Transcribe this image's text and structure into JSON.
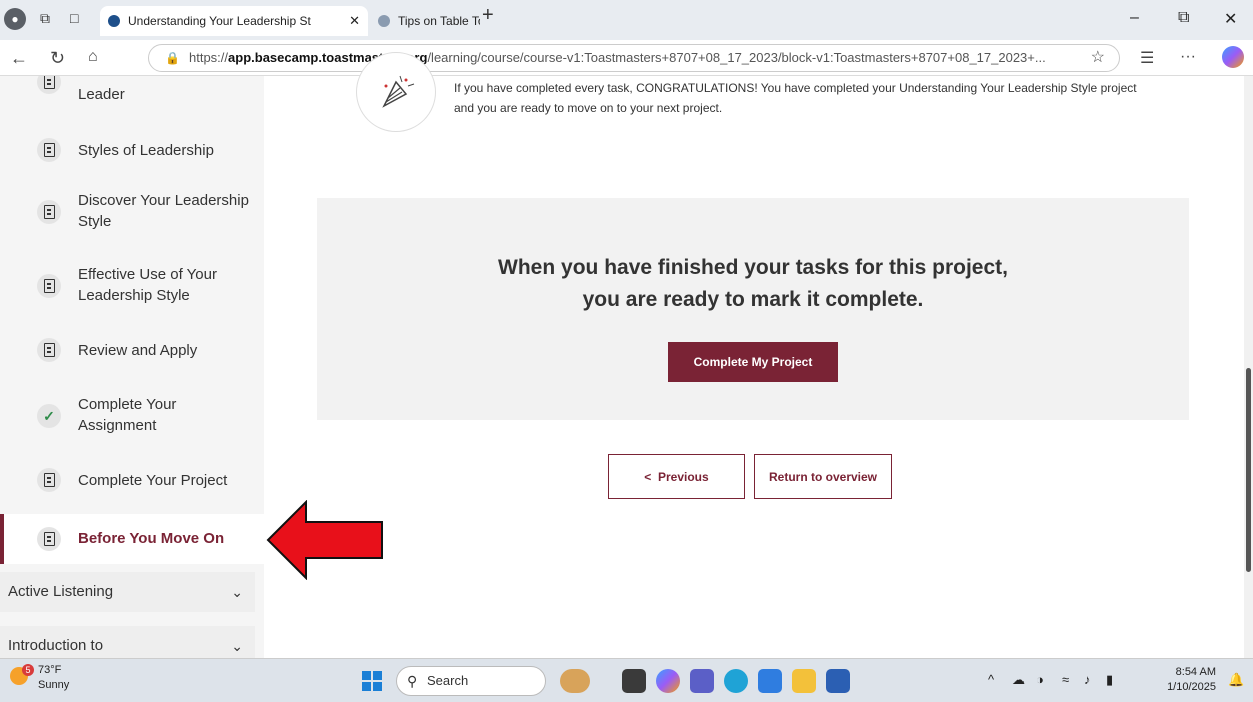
{
  "browser": {
    "tabs": [
      {
        "title": "Understanding Your Leadership St"
      },
      {
        "title": "Tips on Table Topics - Waikiki Toa"
      }
    ],
    "url_domain": "app.basecamp.toastmasters.org",
    "url_prefix": "https://",
    "url_path": "/learning/course/course-v1:Toastmasters+8707+08_17_2023/block-v1:Toastmasters+8707+08_17_2023+..."
  },
  "sidebar": {
    "items": [
      {
        "label": "Leader",
        "icon": "document-icon"
      },
      {
        "label": "Styles of Leadership",
        "icon": "document-icon"
      },
      {
        "label": "Discover Your Leadership Style",
        "icon": "document-icon"
      },
      {
        "label": "Effective Use of Your Leadership Style",
        "icon": "document-icon"
      },
      {
        "label": "Review and Apply",
        "icon": "document-icon"
      },
      {
        "label": "Complete Your Assignment",
        "icon": "checkmark-icon"
      },
      {
        "label": "Complete Your Project",
        "icon": "document-icon"
      },
      {
        "label": "Before You Move On",
        "icon": "document-icon"
      }
    ],
    "sections": [
      {
        "label": "Active Listening"
      },
      {
        "label": "Introduction to"
      }
    ]
  },
  "main": {
    "congrats_text": "If you have completed every task, CONGRATULATIONS! You have completed your Understanding Your Leadership Style project and you are ready to move on to your next project.",
    "complete_title_line1": "When you have finished your tasks for this project,",
    "complete_title_line2": "you are ready to mark it complete.",
    "complete_button": "Complete My Project",
    "previous_button": "Previous",
    "return_button": "Return to overview"
  },
  "taskbar": {
    "weather_temp": "73°F",
    "weather_desc": "Sunny",
    "weather_badge": "5",
    "search_placeholder": "Search",
    "time": "8:54 AM",
    "date": "1/10/2025"
  },
  "colors": {
    "accent": "#7a2335",
    "arrow": "#e8101a"
  }
}
